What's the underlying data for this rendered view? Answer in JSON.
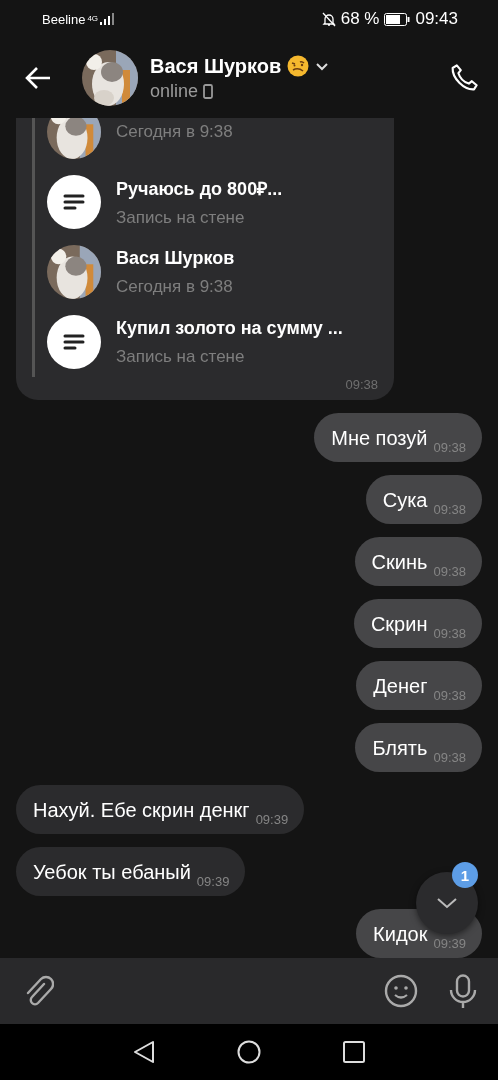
{
  "status_bar": {
    "carrier": "Beeline",
    "network": "4G",
    "battery": "68 %",
    "time": "09:43"
  },
  "header": {
    "name": "Вася Шурков",
    "status": "online"
  },
  "attachments": [
    {
      "kind": "profile",
      "subtitle": "Сегодня в 9:38"
    },
    {
      "kind": "post",
      "title": "Ручаюсь до 800₽...",
      "subtitle": "Запись на стене"
    },
    {
      "kind": "profile",
      "title": "Вася Шурков",
      "subtitle": "Сегодня в 9:38"
    },
    {
      "kind": "post",
      "title": "Купил золото на сумму ...",
      "subtitle": "Запись на стене"
    }
  ],
  "attachments_time": "09:38",
  "messages": [
    {
      "text": "Мне позуй",
      "time": "09:38",
      "outgoing": true
    },
    {
      "text": "Сука",
      "time": "09:38",
      "outgoing": true
    },
    {
      "text": "Скинь",
      "time": "09:38",
      "outgoing": true
    },
    {
      "text": "Скрин",
      "time": "09:38",
      "outgoing": true
    },
    {
      "text": "Денег",
      "time": "09:38",
      "outgoing": true
    },
    {
      "text": "Блять",
      "time": "09:38",
      "outgoing": true
    },
    {
      "text": "Нахуй. Ебе скрин денкг",
      "time": "09:39",
      "outgoing": false
    },
    {
      "text": "Уебок ты ебаный",
      "time": "09:39",
      "outgoing": false
    },
    {
      "text": "Кидок",
      "time": "09:39",
      "outgoing": true
    }
  ],
  "scroll_button": {
    "badge": "1"
  }
}
